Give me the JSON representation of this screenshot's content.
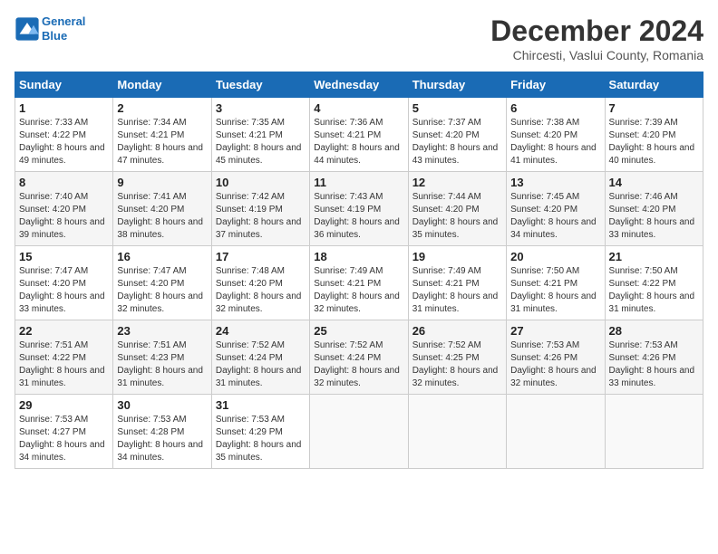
{
  "header": {
    "logo_line1": "General",
    "logo_line2": "Blue",
    "title": "December 2024",
    "subtitle": "Chircesti, Vaslui County, Romania"
  },
  "weekdays": [
    "Sunday",
    "Monday",
    "Tuesday",
    "Wednesday",
    "Thursday",
    "Friday",
    "Saturday"
  ],
  "weeks": [
    [
      {
        "day": "1",
        "sunrise": "7:33 AM",
        "sunset": "4:22 PM",
        "daylight": "8 hours and 49 minutes."
      },
      {
        "day": "2",
        "sunrise": "7:34 AM",
        "sunset": "4:21 PM",
        "daylight": "8 hours and 47 minutes."
      },
      {
        "day": "3",
        "sunrise": "7:35 AM",
        "sunset": "4:21 PM",
        "daylight": "8 hours and 45 minutes."
      },
      {
        "day": "4",
        "sunrise": "7:36 AM",
        "sunset": "4:21 PM",
        "daylight": "8 hours and 44 minutes."
      },
      {
        "day": "5",
        "sunrise": "7:37 AM",
        "sunset": "4:20 PM",
        "daylight": "8 hours and 43 minutes."
      },
      {
        "day": "6",
        "sunrise": "7:38 AM",
        "sunset": "4:20 PM",
        "daylight": "8 hours and 41 minutes."
      },
      {
        "day": "7",
        "sunrise": "7:39 AM",
        "sunset": "4:20 PM",
        "daylight": "8 hours and 40 minutes."
      }
    ],
    [
      {
        "day": "8",
        "sunrise": "7:40 AM",
        "sunset": "4:20 PM",
        "daylight": "8 hours and 39 minutes."
      },
      {
        "day": "9",
        "sunrise": "7:41 AM",
        "sunset": "4:20 PM",
        "daylight": "8 hours and 38 minutes."
      },
      {
        "day": "10",
        "sunrise": "7:42 AM",
        "sunset": "4:19 PM",
        "daylight": "8 hours and 37 minutes."
      },
      {
        "day": "11",
        "sunrise": "7:43 AM",
        "sunset": "4:19 PM",
        "daylight": "8 hours and 36 minutes."
      },
      {
        "day": "12",
        "sunrise": "7:44 AM",
        "sunset": "4:20 PM",
        "daylight": "8 hours and 35 minutes."
      },
      {
        "day": "13",
        "sunrise": "7:45 AM",
        "sunset": "4:20 PM",
        "daylight": "8 hours and 34 minutes."
      },
      {
        "day": "14",
        "sunrise": "7:46 AM",
        "sunset": "4:20 PM",
        "daylight": "8 hours and 33 minutes."
      }
    ],
    [
      {
        "day": "15",
        "sunrise": "7:47 AM",
        "sunset": "4:20 PM",
        "daylight": "8 hours and 33 minutes."
      },
      {
        "day": "16",
        "sunrise": "7:47 AM",
        "sunset": "4:20 PM",
        "daylight": "8 hours and 32 minutes."
      },
      {
        "day": "17",
        "sunrise": "7:48 AM",
        "sunset": "4:20 PM",
        "daylight": "8 hours and 32 minutes."
      },
      {
        "day": "18",
        "sunrise": "7:49 AM",
        "sunset": "4:21 PM",
        "daylight": "8 hours and 32 minutes."
      },
      {
        "day": "19",
        "sunrise": "7:49 AM",
        "sunset": "4:21 PM",
        "daylight": "8 hours and 31 minutes."
      },
      {
        "day": "20",
        "sunrise": "7:50 AM",
        "sunset": "4:21 PM",
        "daylight": "8 hours and 31 minutes."
      },
      {
        "day": "21",
        "sunrise": "7:50 AM",
        "sunset": "4:22 PM",
        "daylight": "8 hours and 31 minutes."
      }
    ],
    [
      {
        "day": "22",
        "sunrise": "7:51 AM",
        "sunset": "4:22 PM",
        "daylight": "8 hours and 31 minutes."
      },
      {
        "day": "23",
        "sunrise": "7:51 AM",
        "sunset": "4:23 PM",
        "daylight": "8 hours and 31 minutes."
      },
      {
        "day": "24",
        "sunrise": "7:52 AM",
        "sunset": "4:24 PM",
        "daylight": "8 hours and 31 minutes."
      },
      {
        "day": "25",
        "sunrise": "7:52 AM",
        "sunset": "4:24 PM",
        "daylight": "8 hours and 32 minutes."
      },
      {
        "day": "26",
        "sunrise": "7:52 AM",
        "sunset": "4:25 PM",
        "daylight": "8 hours and 32 minutes."
      },
      {
        "day": "27",
        "sunrise": "7:53 AM",
        "sunset": "4:26 PM",
        "daylight": "8 hours and 32 minutes."
      },
      {
        "day": "28",
        "sunrise": "7:53 AM",
        "sunset": "4:26 PM",
        "daylight": "8 hours and 33 minutes."
      }
    ],
    [
      {
        "day": "29",
        "sunrise": "7:53 AM",
        "sunset": "4:27 PM",
        "daylight": "8 hours and 34 minutes."
      },
      {
        "day": "30",
        "sunrise": "7:53 AM",
        "sunset": "4:28 PM",
        "daylight": "8 hours and 34 minutes."
      },
      {
        "day": "31",
        "sunrise": "7:53 AM",
        "sunset": "4:29 PM",
        "daylight": "8 hours and 35 minutes."
      },
      null,
      null,
      null,
      null
    ]
  ]
}
